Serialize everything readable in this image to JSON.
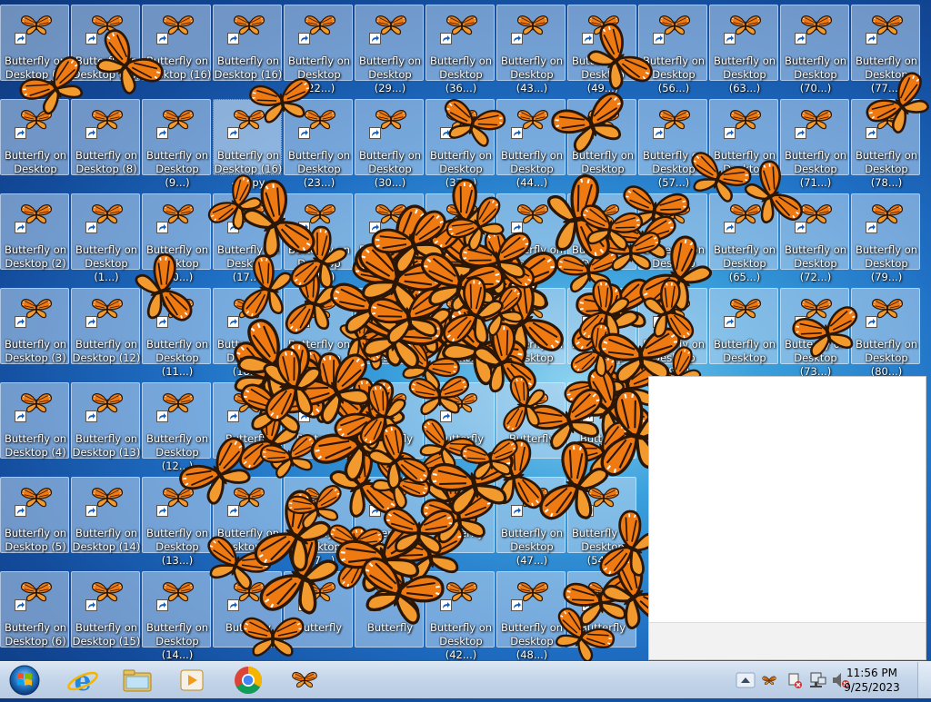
{
  "desktop": {
    "columns": [
      [
        "Butterfly on Desktop (?)",
        "Butterfly on Desktop",
        "Butterfly on Desktop (2)",
        "Butterfly on Desktop (3)",
        "Butterfly on Desktop (4)",
        "Butterfly on Desktop (5)",
        "Butterfly on Desktop (6)"
      ],
      [
        "Butterfly on Desktop (16)",
        "Butterfly on Desktop (8)",
        "Butterfly on Desktop (1...)",
        "Butterfly on Desktop (12)",
        "Butterfly on Desktop (13)",
        "Butterfly on Desktop (14)",
        "Butterfly on Desktop (15)"
      ],
      [
        "Butterfly on Desktop (16)",
        "Butterfly on Desktop (9...)",
        "Butterfly on Desktop (10...)",
        "Butterfly on Desktop (11...)",
        "Butterfly on Desktop (12...)",
        "Butterfly on Desktop (13...)",
        "Butterfly on Desktop (14...)"
      ],
      [
        "Butterfly on Desktop (16)",
        "Butterfly on Desktop (16) - Copy",
        "Butterfly on Desktop (17...)",
        "Butterfly on Desktop (18...)",
        "Butterfly",
        "Butterfly on Desktop (?)",
        "Butterfly"
      ],
      [
        "Butterfly on Desktop (22...)",
        "Butterfly on Desktop (23...)",
        "Butterfly on Desktop (24...)",
        "Butterfly on Desktop (25...)",
        "Butterfly",
        "Butterfly on Desktop (27...)",
        "Butterfly"
      ],
      [
        "Butterfly on Desktop (29...)",
        "Butterfly on Desktop (30...)",
        "Butterfly on Desktop",
        "Butterfly on Desktop",
        "Butterfly",
        "Butterfly on Desktop (?)",
        "Butterfly"
      ],
      [
        "Butterfly on Desktop (36...)",
        "Butterfly on Desktop (37...)",
        "Butterfly on Desktop",
        "Butterfly on Desktop",
        "Butterfly",
        "Butterfly",
        "Butterfly on Desktop (42...)"
      ],
      [
        "Butterfly on Desktop (43...)",
        "Butterfly on Desktop (44...)",
        "Butterfly on Desktop",
        "Butterfly on Desktop",
        "Butterfly",
        "Butterfly on Desktop (47...)",
        "Butterfly on Desktop (48...)"
      ],
      [
        "Butterfly on Desktop (49...)",
        "Butterfly on Desktop",
        "Butterfly on Desktop",
        "Butterfly on Desktop",
        "Butterfly",
        "Butterfly on Desktop (54...)",
        "Butterfly"
      ],
      [
        "Butterfly on Desktop (56...)",
        "Butterfly on Desktop (57...)",
        "Butterfly on Desktop",
        "Butterfly on Desktop (59...)",
        "",
        "",
        ""
      ],
      [
        "Butterfly on Desktop (63...)",
        "Butterfly on Desktop",
        "Butterfly on Desktop (65...)",
        "Butterfly on Desktop",
        "",
        "",
        ""
      ],
      [
        "Butterfly on Desktop (70...)",
        "Butterfly on Desktop (71...)",
        "Butterfly on Desktop (72...)",
        "Butterfly on Desktop (73...)",
        "",
        "",
        ""
      ],
      [
        "Butterfly on Desktop (77...)",
        "Butterfly on Desktop (78...)",
        "Butterfly on Desktop (79...)",
        "Butterfly on Desktop (80...)",
        "",
        "",
        ""
      ]
    ],
    "selected_icon_label": "Butterfly on Desktop (16) - Copy"
  },
  "taskbar": {
    "start_button": "start-orb",
    "pinned": [
      "internet-explorer-icon",
      "file-explorer-icon",
      "media-player-icon",
      "chrome-icon",
      "butterfly-app-icon"
    ],
    "tray": {
      "icons": [
        "show-hidden-icons-chevron",
        "butterfly-tray-icon",
        "action-center-icon",
        "network-icon",
        "volume-muted-icon"
      ],
      "time": "11:56 PM",
      "date": "9/25/2023"
    }
  },
  "colors": {
    "butterfly_orange": "#f07a12",
    "butterfly_vein": "#2a1606",
    "icon_tile": "#bdd7f0",
    "taskbar": "#c5d6ea"
  }
}
